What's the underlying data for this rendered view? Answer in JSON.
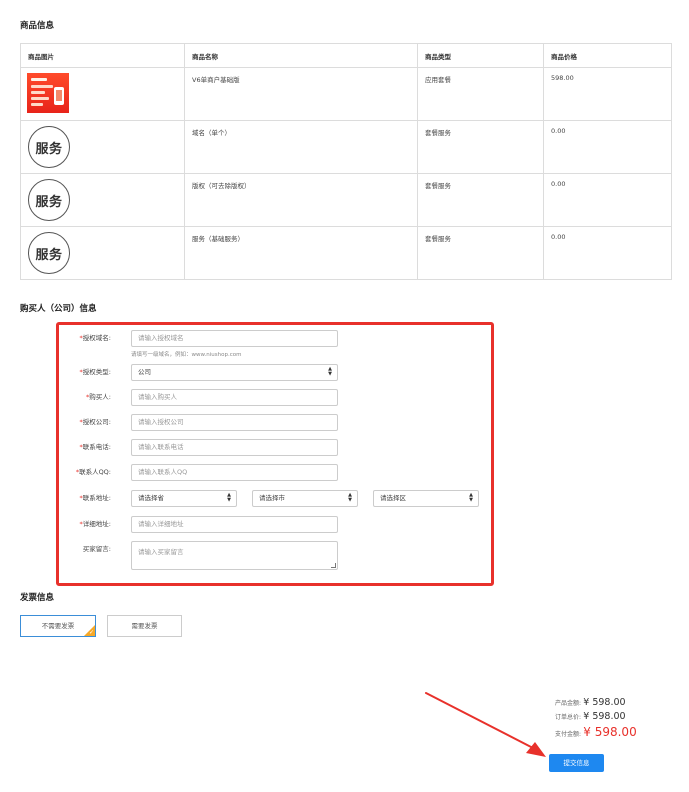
{
  "product_section": {
    "title": "商品信息",
    "columns": [
      "商品图片",
      "商品名称",
      "商品类型",
      "商品价格"
    ],
    "rows": [
      {
        "image": "product-thumbnail",
        "name": "V6单商户基础版",
        "type": "应用套餐",
        "price": "598.00"
      },
      {
        "image": "service-icon",
        "icon_text": "服务",
        "name": "域名（单个）",
        "type": "套餐服务",
        "price": "0.00"
      },
      {
        "image": "service-icon",
        "icon_text": "服务",
        "name": "版权（可去除版权）",
        "type": "套餐服务",
        "price": "0.00"
      },
      {
        "image": "service-icon",
        "icon_text": "服务",
        "name": "服务（基础服务）",
        "type": "套餐服务",
        "price": "0.00"
      }
    ]
  },
  "buyer_section": {
    "title": "购买人（公司）信息",
    "required_mark": "*",
    "fields": {
      "domain": {
        "label": "授权域名:",
        "placeholder": "请输入授权域名",
        "hint": "请填写一级域名，例如：www.niushop.com"
      },
      "auth_type": {
        "label": "授权类型:",
        "value": "公司"
      },
      "buyer": {
        "label": "购买人:",
        "placeholder": "请输入购买人"
      },
      "company": {
        "label": "授权公司:",
        "placeholder": "请输入授权公司"
      },
      "phone": {
        "label": "联系电话:",
        "placeholder": "请输入联系电话"
      },
      "qq": {
        "label": "联系人QQ:",
        "placeholder": "请输入联系人QQ"
      },
      "address": {
        "label": "联系地址:",
        "province": "请选择省",
        "city": "请选择市",
        "district": "请选择区"
      },
      "detail_address": {
        "label": "详细地址:",
        "placeholder": "请输入详细地址"
      },
      "message": {
        "label": "买家留言:",
        "placeholder": "请输入买家留言"
      }
    }
  },
  "invoice_section": {
    "title": "发票信息",
    "options": [
      "不需要发票",
      "需要发票"
    ],
    "selected": "不需要发票"
  },
  "totals": {
    "product_amount_label": "产品金额:",
    "product_amount": "¥ 598.00",
    "order_total_label": "订单总价:",
    "order_total": "¥ 598.00",
    "pay_amount_label": "支付金额:",
    "pay_amount": "¥ 598.00"
  },
  "submit_label": "提交信息",
  "colors": {
    "highlight_box": "#e8312b",
    "arrow": "#e8312b",
    "submit": "#1e88f0",
    "price_red": "#e8312b"
  }
}
